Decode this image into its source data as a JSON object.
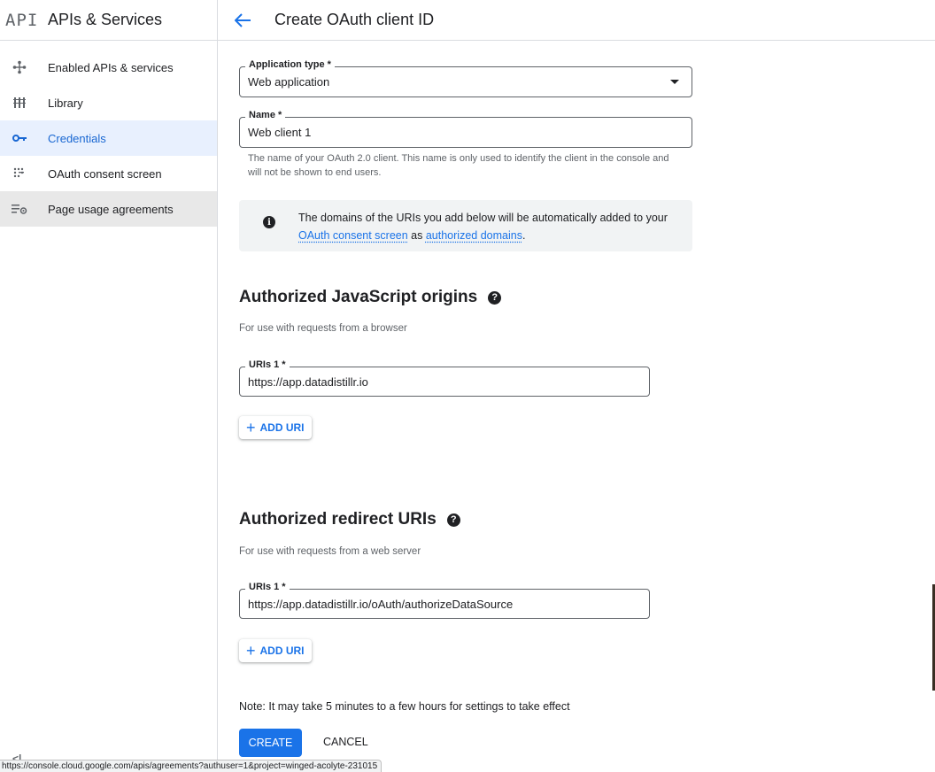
{
  "sidebar": {
    "logo": "API",
    "title": "APIs & Services",
    "items": [
      {
        "label": "Enabled APIs & services",
        "icon": "move-arrows-icon"
      },
      {
        "label": "Library",
        "icon": "library-icon"
      },
      {
        "label": "Credentials",
        "icon": "key-icon"
      },
      {
        "label": "OAuth consent screen",
        "icon": "consent-grid-icon"
      },
      {
        "label": "Page usage agreements",
        "icon": "settings-list-icon"
      }
    ],
    "collapse_label": "<|"
  },
  "header": {
    "title": "Create OAuth client ID"
  },
  "form": {
    "app_type_label": "Application type *",
    "app_type_value": "Web application",
    "name_label": "Name *",
    "name_value": "Web client 1",
    "name_helper": "The name of your OAuth 2.0 client. This name is only used to identify the client in the console and will not be shown to end users."
  },
  "info": {
    "text_before": "The domains of the URIs you add below will be automatically added to your ",
    "link1": "OAuth consent screen",
    "text_mid": " as ",
    "link2": "authorized domains",
    "text_after": "."
  },
  "js_origins": {
    "heading": "Authorized JavaScript origins",
    "subtitle": "For use with requests from a browser",
    "uri_label": "URIs 1 *",
    "uri_value": "https://app.datadistillr.io",
    "add_label": "ADD URI"
  },
  "redirect_uris": {
    "heading": "Authorized redirect URIs",
    "subtitle": "For use with requests from a web server",
    "uri_label": "URIs 1 *",
    "uri_value": "https://app.datadistillr.io/oAuth/authorizeDataSource",
    "add_label": "ADD URI"
  },
  "footer": {
    "note": "Note: It may take 5 minutes to a few hours for settings to take effect",
    "create_label": "CREATE",
    "cancel_label": "CANCEL"
  },
  "status_bar": {
    "url": "https://console.cloud.google.com/apis/agreements?authuser=1&project=winged-acolyte-231015"
  },
  "colors": {
    "accent": "#1a73e8",
    "active_bg": "#e8f0fe",
    "info_bg": "#f1f3f4"
  }
}
